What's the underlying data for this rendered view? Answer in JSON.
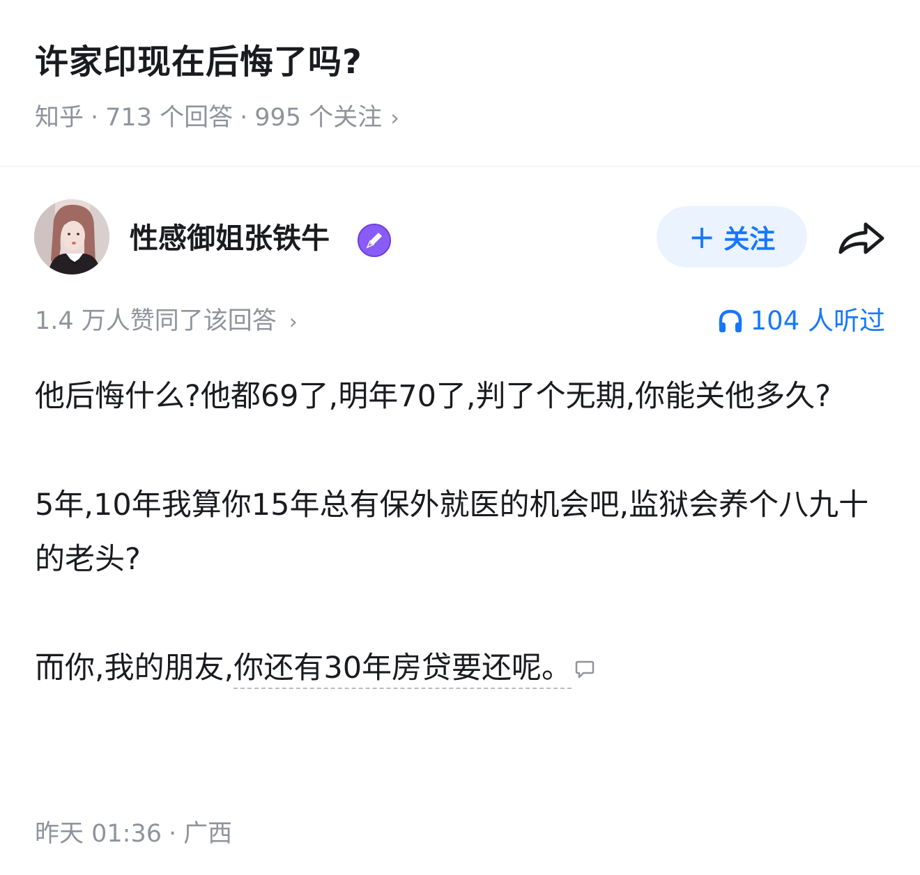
{
  "question": {
    "title": "许家印现在后悔了吗?",
    "source": "知乎",
    "answers": "713 个回答",
    "followers": "995 个关注",
    "separator": "·"
  },
  "author": {
    "name": "性感御姐张铁牛",
    "badge_icon": "pen-badge-icon",
    "follow_label": "关注",
    "follow_icon": "plus-icon",
    "share_icon": "share-arrow-icon"
  },
  "stats": {
    "votes": "1.4 万人赞同了该回答",
    "listens": "104 人听过",
    "listen_icon": "headphones-icon"
  },
  "content": {
    "para1": "他后悔什么?他都69了,明年70了,判了个无期,你能关他多久?",
    "para2": "5年,10年我算你15年总有保外就医的机会吧,监狱会养个八九十的老头?",
    "para3_prefix": "而你,我的朋友,",
    "para3_underlined": "你还有30年房贷要还呢。",
    "comment_icon": "comment-bubble-icon"
  },
  "footer": {
    "time": "昨天 01:36",
    "location": "广西"
  },
  "colors": {
    "accent": "#1677ff",
    "follow_bg": "#ebf3ff",
    "meta_gray": "#8f939b",
    "badge_purple": "#8a5cf6"
  }
}
